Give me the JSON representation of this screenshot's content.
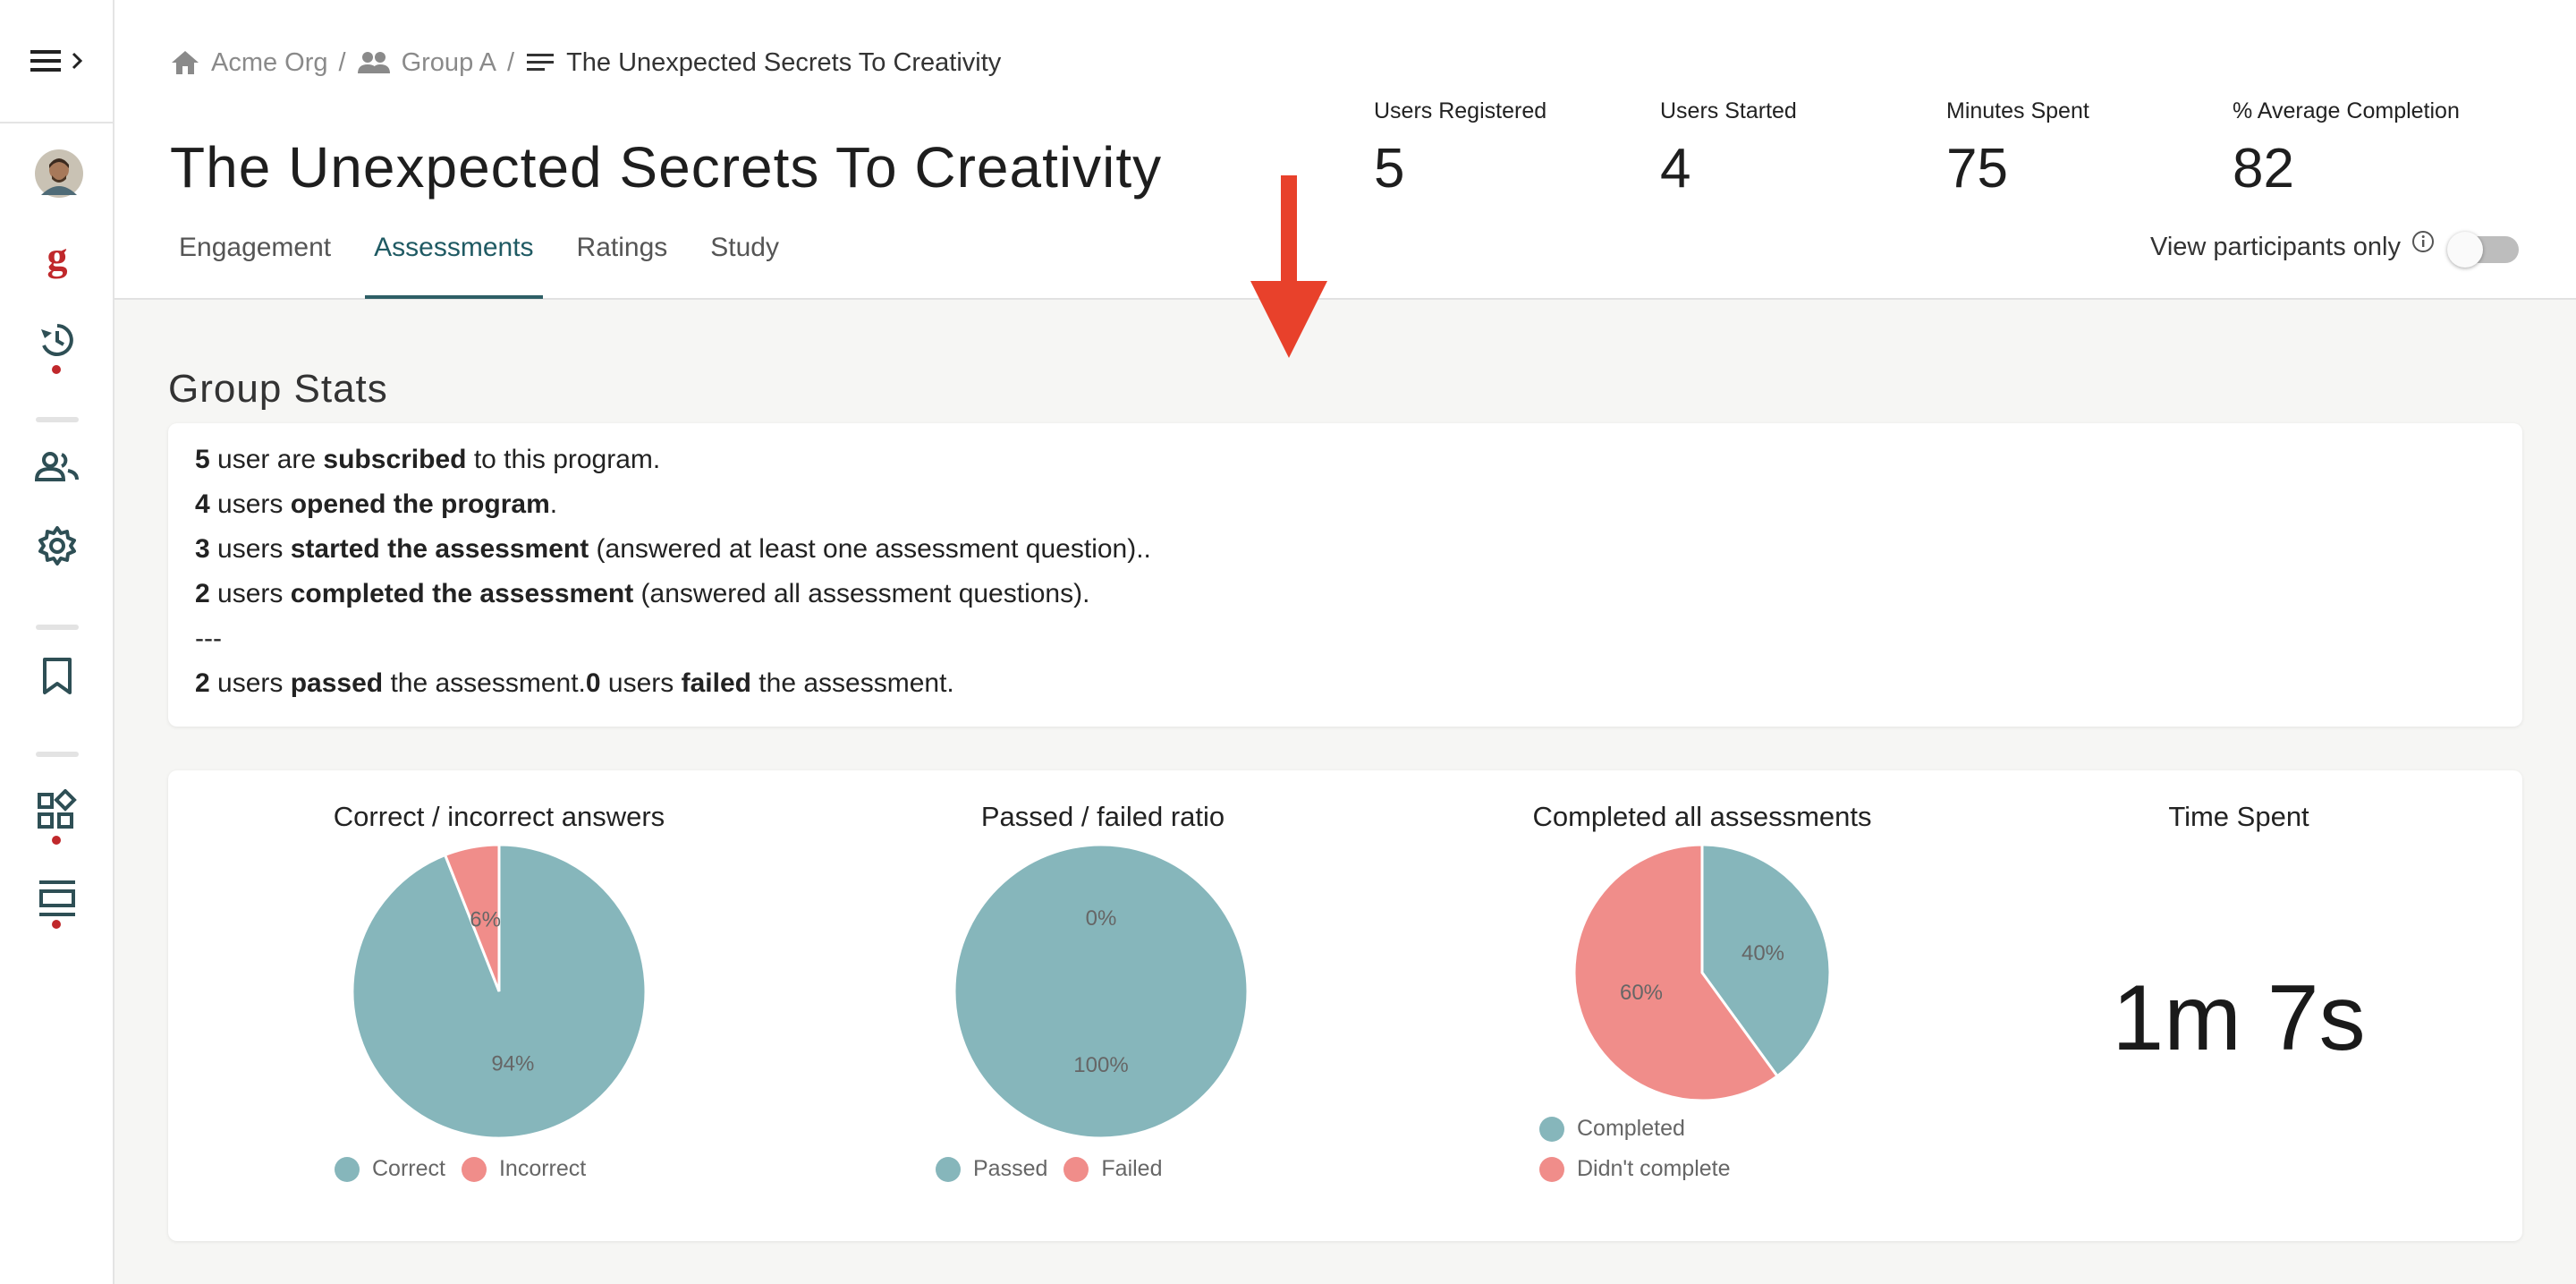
{
  "breadcrumb": {
    "org": "Acme Org",
    "group": "Group A",
    "current": "The Unexpected Secrets To Creativity",
    "separator": "/"
  },
  "page_title": "The Unexpected Secrets To Creativity",
  "tabs": [
    {
      "label": "Engagement"
    },
    {
      "label": "Assessments",
      "active": true
    },
    {
      "label": "Ratings"
    },
    {
      "label": "Study"
    }
  ],
  "kpis": [
    {
      "label": "Users Registered",
      "value": "5"
    },
    {
      "label": "Users Started",
      "value": "4"
    },
    {
      "label": "Minutes Spent",
      "value": "75"
    },
    {
      "label": "% Average Completion",
      "value": "82"
    }
  ],
  "view_participants": {
    "label": "View participants only",
    "enabled": false
  },
  "group_stats": {
    "title": "Group Stats",
    "lines": [
      {
        "n": "5",
        "a": " user are ",
        "b": "subscribed",
        "c": " to this program."
      },
      {
        "n": "4",
        "a": " users ",
        "b": "opened the program",
        "c": "."
      },
      {
        "n": "3",
        "a": " users ",
        "b": "started the assessment",
        "c": " (answered at least one assessment question).."
      },
      {
        "n": "2",
        "a": " users ",
        "b": "completed the assessment",
        "c": " (answered all assessment questions)."
      },
      {
        "n": "",
        "a": "---",
        "b": "",
        "c": ""
      }
    ],
    "last_line": {
      "n1": "2",
      "t1": " users ",
      "b1": "passed",
      "t2": " the assessment.",
      "n2": "0",
      "t3": " users ",
      "b2": "failed",
      "t4": " the assessment."
    }
  },
  "colors": {
    "teal": "#86b6bb",
    "salmon": "#f08d8a",
    "accent": "#2e5f66",
    "arrow": "#e8412b"
  },
  "chart_data": [
    {
      "type": "pie",
      "title": "Correct / incorrect answers",
      "labels": [
        "Correct",
        "Incorrect"
      ],
      "values": [
        94,
        6
      ],
      "value_labels": [
        "94%",
        "6%"
      ]
    },
    {
      "type": "pie",
      "title": "Passed / failed ratio",
      "labels": [
        "Passed",
        "Failed"
      ],
      "values": [
        100,
        0
      ],
      "value_labels": [
        "100%",
        "0%"
      ]
    },
    {
      "type": "pie",
      "title": "Completed all assessments",
      "labels": [
        "Completed",
        "Didn't complete"
      ],
      "values": [
        40,
        60
      ],
      "value_labels": [
        "40%",
        "60%"
      ]
    }
  ],
  "time_spent": {
    "title": "Time Spent",
    "value": "1m 7s"
  }
}
